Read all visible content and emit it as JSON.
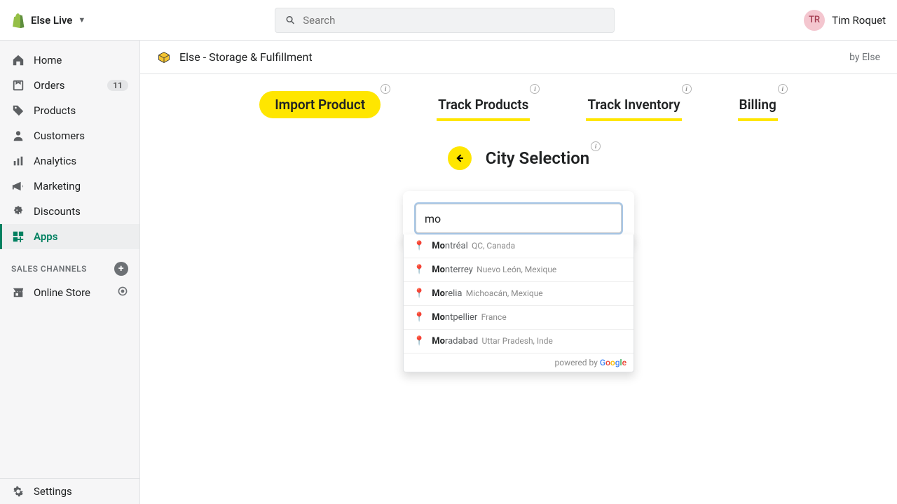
{
  "header": {
    "store_name": "Else Live",
    "search_placeholder": "Search",
    "user_initials": "TR",
    "user_name": "Tim Roquet"
  },
  "sidebar": {
    "items": [
      {
        "label": "Home",
        "icon": "home"
      },
      {
        "label": "Orders",
        "icon": "orders",
        "badge": "11"
      },
      {
        "label": "Products",
        "icon": "products"
      },
      {
        "label": "Customers",
        "icon": "customers"
      },
      {
        "label": "Analytics",
        "icon": "analytics"
      },
      {
        "label": "Marketing",
        "icon": "marketing"
      },
      {
        "label": "Discounts",
        "icon": "discounts"
      },
      {
        "label": "Apps",
        "icon": "apps"
      }
    ],
    "sales_channels_label": "SALES CHANNELS",
    "online_store": "Online Store",
    "settings": "Settings"
  },
  "app": {
    "title": "Else - Storage & Fulfillment",
    "by": "by Else"
  },
  "tabs": [
    {
      "label": "Import Product",
      "style": "pill"
    },
    {
      "label": "Track Products",
      "style": "underline"
    },
    {
      "label": "Track Inventory",
      "style": "underline"
    },
    {
      "label": "Billing",
      "style": "underline"
    }
  ],
  "section": {
    "title": "City Selection",
    "input_value": "mo"
  },
  "suggestions": [
    {
      "bold": "Mo",
      "rest": "ntréal",
      "meta": "QC, Canada"
    },
    {
      "bold": "Mo",
      "rest": "nterrey",
      "meta": "Nuevo León, Mexique"
    },
    {
      "bold": "Mo",
      "rest": "relia",
      "meta": "Michoacán, Mexique"
    },
    {
      "bold": "Mo",
      "rest": "ntpellier",
      "meta": "France"
    },
    {
      "bold": "Mo",
      "rest": "radabad",
      "meta": "Uttar Pradesh, Inde"
    }
  ],
  "powered_by": "powered by"
}
